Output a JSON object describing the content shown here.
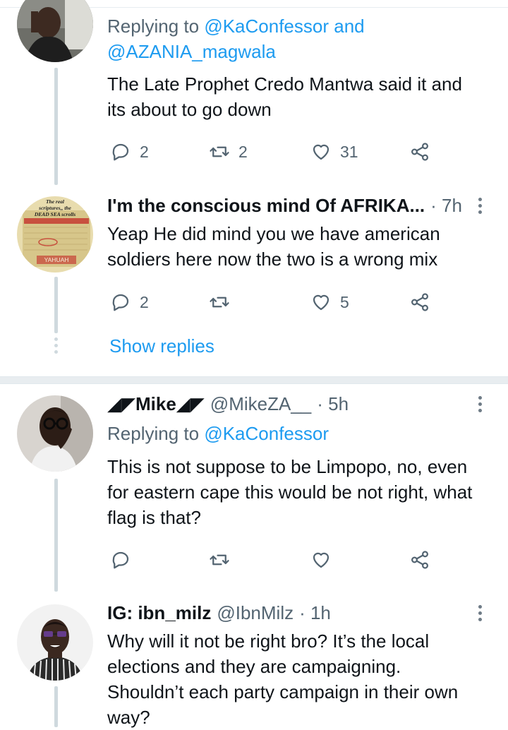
{
  "tweets": [
    {
      "replying_prefix": "Replying to",
      "replying_to": "@KaConfessor and",
      "replying_to_line2": "@AZANIA_magwala",
      "text_lines": [
        "The Late Prophet Credo Mantwa said it and",
        "its about to go down"
      ],
      "actions": {
        "reply_count": "2",
        "retweet_count": "2",
        "like_count": "31"
      }
    },
    {
      "name": "I'm the conscious mind Of AFRIKA...",
      "time": "· 7h",
      "avatar_text": {
        "line1": "The real",
        "line2": "scriptures,, the",
        "line3": "DEAD SEA scrolls",
        "line4": "YAHUAH"
      },
      "text_lines": [
        "Yeap He did mind you we have american",
        "soldiers here now the two is a wrong mix"
      ],
      "actions": {
        "reply_count": "2",
        "retweet_count": "",
        "like_count": "5"
      }
    },
    {
      "name": "◢◤Mike◢◤",
      "handle": "@MikeZA__",
      "time": "· 5h",
      "replying_prefix": "Replying to",
      "replying_to": "@KaConfessor",
      "text_lines": [
        "This is not suppose to be Limpopo, no, even",
        "for eastern cape this would be not right, what",
        "flag is that?"
      ],
      "actions": {
        "reply_count": "",
        "retweet_count": "",
        "like_count": ""
      }
    },
    {
      "name": "IG: ibn_milz",
      "handle": "@IbnMilz",
      "time": "· 1h",
      "text_lines": [
        "Why will it not be right bro? It’s the local",
        "elections and they are campaigning.",
        "Shouldn’t each party campaign in their own",
        "way?"
      ]
    }
  ],
  "show_replies": "Show replies",
  "icons": {
    "reply": "reply-icon",
    "retweet": "retweet-icon",
    "like": "heart-icon",
    "share": "share-icon",
    "more": "more-vertical-icon"
  },
  "colors": {
    "link": "#1d9bf0",
    "secondary_text": "#536471",
    "thread_line": "#cfd9de",
    "divider": "#e8edf0"
  }
}
